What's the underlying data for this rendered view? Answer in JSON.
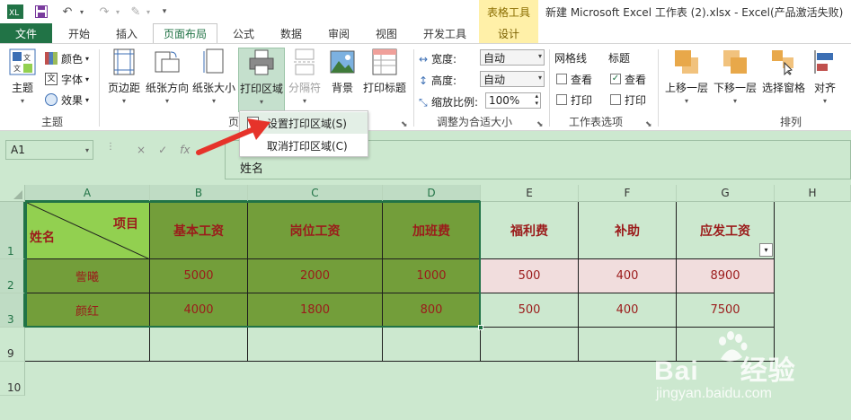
{
  "colors": {
    "file_tab": "#217346",
    "context_tab": "#fff0a8",
    "grid_bg": "#cce8cf",
    "header_dark": "#739e3a",
    "header_light": "#92d050",
    "pink_row": "#f1dddd",
    "text_red": "#9b1b1b",
    "annotation_arrow": "#e6332a"
  },
  "title_bar": {
    "app_icon": "excel-logo-icon",
    "document_title": "新建 Microsoft Excel 工作表 (2).xlsx - Excel(产品激活失败)",
    "context_group": "表格工具"
  },
  "tabs": {
    "file": "文件",
    "home": "开始",
    "insert": "插入",
    "page_layout": "页面布局",
    "formulas": "公式",
    "data": "数据",
    "review": "审阅",
    "view": "视图",
    "developer": "开发工具",
    "design": "设计",
    "active": "页面布局"
  },
  "ribbon": {
    "themes": {
      "themes_button": "主题",
      "colors": "颜色",
      "fonts": "字体",
      "effects": "效果",
      "group_label": "主题"
    },
    "page_setup": {
      "margins": "页边距",
      "orientation": "纸张方向",
      "size": "纸张大小",
      "print_area": "打印区域",
      "breaks": "分隔符",
      "background": "背景",
      "print_titles": "打印标题",
      "group_label_partial": "页"
    },
    "scale_to_fit": {
      "width_label": "宽度:",
      "width_value": "自动",
      "height_label": "高度:",
      "height_value": "自动",
      "scale_label": "缩放比例:",
      "scale_value": "100%",
      "group_label": "调整为合适大小"
    },
    "sheet_options": {
      "gridlines_label": "网格线",
      "headings_label": "标题",
      "view": "查看",
      "print": "打印",
      "gridlines_view_checked": false,
      "gridlines_print_checked": false,
      "headings_view_checked": true,
      "headings_print_checked": false,
      "group_label": "工作表选项"
    },
    "arrange": {
      "bring_forward": "上移一层",
      "send_backward": "下移一层",
      "selection_pane": "选择窗格",
      "align": "对齐",
      "group_label": "排列"
    }
  },
  "print_area_menu": {
    "set": "设置打印区域(S)",
    "clear": "取消打印区域(C)"
  },
  "formula_bar": {
    "name_box": "A1",
    "cancel_icon": "×",
    "enter_icon": "✓",
    "fx_icon": "fx",
    "content": "姓名"
  },
  "sheet": {
    "columns": [
      "A",
      "B",
      "C",
      "D",
      "E",
      "F",
      "G",
      "H"
    ],
    "rows": [
      "1",
      "2",
      "3",
      "9",
      "10"
    ],
    "diag_top_right": "项目",
    "diag_bottom_left": "姓名",
    "headers": [
      "基本工资",
      "岗位工资",
      "加班费",
      "福利费",
      "补助",
      "应发工资"
    ],
    "data": [
      {
        "name": "訾曦",
        "values": [
          "5000",
          "2000",
          "1000",
          "500",
          "400",
          "8900"
        ]
      },
      {
        "name": "颜红",
        "values": [
          "4000",
          "1800",
          "800",
          "500",
          "400",
          "7500"
        ]
      }
    ]
  },
  "watermark": {
    "brand": "Bai",
    "brand_suffix": "经验",
    "url": "jingyan.baidu.com"
  }
}
